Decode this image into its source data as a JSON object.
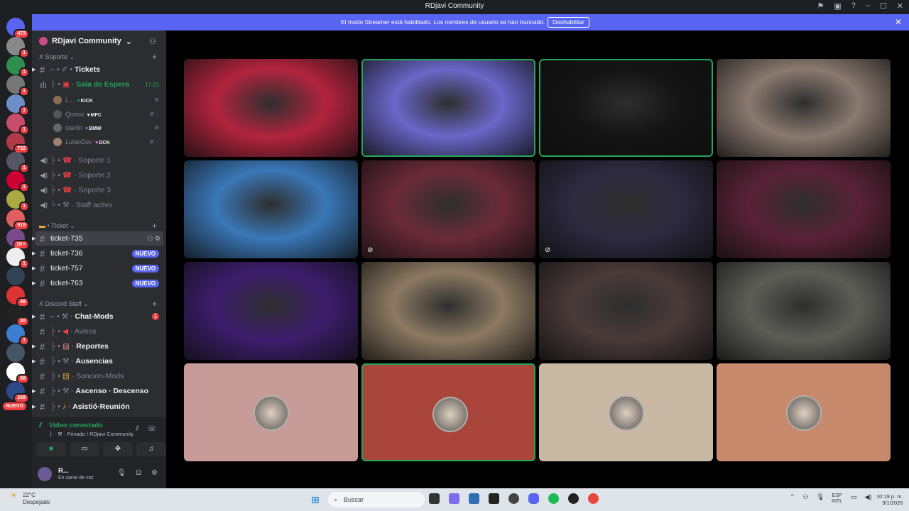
{
  "window": {
    "title": "RDjavi Community"
  },
  "streamer_banner": {
    "message": "El modo Streamer está habilitado. Los nombres de usuario se han truncado.",
    "button": "Deshabilitar"
  },
  "server_badges": [
    "473",
    "1",
    "1",
    "1",
    "1",
    "1",
    "732",
    "1",
    "1",
    "1",
    "515",
    "1K+",
    "1",
    "48",
    "30",
    "1",
    "58",
    "268"
  ],
  "server_nuevo": "NUEVO",
  "guild": {
    "name": "RDjavi Community"
  },
  "categories": {
    "soporte": "X Soporte",
    "ticket": "Ticket",
    "staff": "X Discord Staff"
  },
  "channels": {
    "tickets": "Tickets",
    "sala": "Sala de Espera",
    "sala_time": "17:23",
    "soporte1": "Soporte 1",
    "soporte2": "Soporte 2",
    "soporte3": "Soporte 3",
    "staff_activo": "Staff activo",
    "t735": "ticket-735",
    "t736": "ticket-736",
    "t757": "ticket-757",
    "t763": "ticket-763",
    "chat_mods": "Chat-Mods",
    "avisos": "Avisos",
    "reportes": "Reportes",
    "ausencias": "Ausencias",
    "sancion": "Sancion-Mods",
    "ascenso": "Ascenso · Descenso",
    "asistio": "Asistió·Reunión"
  },
  "badges": {
    "nuevo": "NUEVO",
    "chat_mods_count": "1"
  },
  "voice_users": [
    {
      "name": "L...",
      "tag": "KICK"
    },
    {
      "name": "Quiroz",
      "tag": "MFC"
    },
    {
      "name": "starlin",
      "tag": "BMW"
    },
    {
      "name": "LuianDev",
      "tag": "DCN"
    }
  ],
  "voice": {
    "status": "Video conectado",
    "sub": "Privado / RDjavi Community"
  },
  "user": {
    "name": "R...",
    "status": "En canal de voz"
  },
  "tiles": [
    {
      "kind": "video",
      "color": "#b3243e",
      "speaking": false
    },
    {
      "kind": "video",
      "color": "#6a67c9",
      "speaking": true
    },
    {
      "kind": "video",
      "color": "#141414",
      "speaking": true
    },
    {
      "kind": "video",
      "color": "#8a7a70",
      "speaking": false
    },
    {
      "kind": "video",
      "color": "#3a78b8",
      "speaking": false
    },
    {
      "kind": "video",
      "color": "#6b2a3a",
      "speaking": false,
      "muted": true
    },
    {
      "kind": "video",
      "color": "#2d2a3f",
      "speaking": false,
      "muted": true
    },
    {
      "kind": "video",
      "color": "#5a2236",
      "speaking": false
    },
    {
      "kind": "video",
      "color": "#3d1e6e",
      "speaking": false
    },
    {
      "kind": "video",
      "color": "#8c7a63",
      "speaking": false
    },
    {
      "kind": "video",
      "color": "#4a3a3a",
      "speaking": false
    },
    {
      "kind": "video",
      "color": "#5d5d58",
      "speaking": false
    },
    {
      "kind": "avatar",
      "color": "#c79c98",
      "speaking": false
    },
    {
      "kind": "avatar",
      "color": "#a9453b",
      "speaking": true
    },
    {
      "kind": "avatar",
      "color": "#c9b8a4",
      "speaking": false
    },
    {
      "kind": "avatar",
      "color": "#c88a6d",
      "speaking": false
    }
  ],
  "taskbar": {
    "temp": "22°C",
    "weather": "Despejado",
    "search": "Buscar",
    "lang1": "ESP",
    "lang2": "INTL",
    "time": "10:19 p. m.",
    "date": "9/1/2026"
  }
}
